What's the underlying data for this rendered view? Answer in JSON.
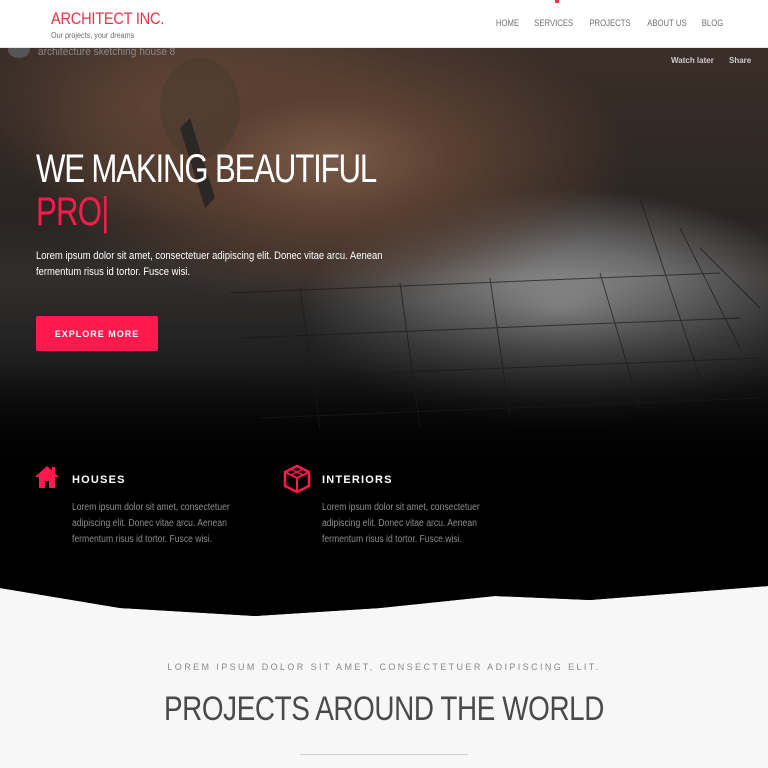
{
  "colors": {
    "accent": "#ff1a4d",
    "brand": "#e8334a",
    "section_bg": "#f7f7f7"
  },
  "header": {
    "brand_name": "ARCHITECT INC.",
    "tagline": "Our projects, your dreams",
    "nav": [
      {
        "label": "HOME"
      },
      {
        "label": "SERVICES"
      },
      {
        "label": "PROJECTS"
      },
      {
        "label": "ABOUT US"
      },
      {
        "label": "BLOG"
      }
    ]
  },
  "video": {
    "title": "architecture sketching house 8",
    "watch_later": "Watch later",
    "share": "Share"
  },
  "hero": {
    "headline": "WE MAKING BEAUTIFUL",
    "typed": "PRO|",
    "text_line1": "Lorem ipsum dolor sit amet, consectetuer adipiscing elit. Donec vitae arcu. Aenean",
    "text_line2": "fermentum risus id tortor. Fusce wisi.",
    "cta_label": "EXPLORE MORE"
  },
  "features": [
    {
      "icon": "home-icon",
      "title": "HOUSES",
      "lines": [
        "Lorem ipsum dolor sit amet, consectetuer",
        "adipiscing elit. Donec vitae arcu. Aenean",
        "fermentum risus id tortor. Fusce wisi."
      ]
    },
    {
      "icon": "cube-icon",
      "title": "INTERIORS",
      "lines": [
        "Lorem ipsum dolor sit amet, consectetuer",
        "adipiscing elit. Donec vitae arcu. Aenean",
        "fermentum risus id tortor. Fusce.wisi."
      ]
    }
  ],
  "projects": {
    "subtitle": "LOREM IPSUM DOLOR SIT AMET, CONSECTETUER ADIPISCING ELIT.",
    "title": "PROJECTS AROUND THE WORLD"
  }
}
